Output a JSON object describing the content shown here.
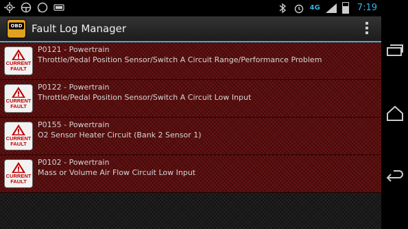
{
  "status_bar": {
    "time": "7:19",
    "network": "4G",
    "left_icons": [
      "gps-icon",
      "steering-wheel-icon",
      "whatsapp-icon",
      "obd-icon"
    ],
    "right_icons": [
      "bluetooth-icon",
      "alarm-icon",
      "lte-icon",
      "signal-icon",
      "battery-icon"
    ]
  },
  "action_bar": {
    "app_icon_label": "OBD",
    "title": "Fault Log Manager"
  },
  "faults": [
    {
      "code": "P0121 - Powertrain",
      "description": "Throttle/Pedal Position Sensor/Switch A Circuit Range/Performance Problem",
      "status_line1": "CURRENT",
      "status_line2": "FAULT"
    },
    {
      "code": "P0122 - Powertrain",
      "description": "Throttle/Pedal Position Sensor/Switch A Circuit Low Input",
      "status_line1": "CURRENT",
      "status_line2": "FAULT"
    },
    {
      "code": "P0155 - Powertrain",
      "description": "O2 Sensor Heater Circuit (Bank 2 Sensor 1)",
      "status_line1": "CURRENT",
      "status_line2": "FAULT"
    },
    {
      "code": "P0102 - Powertrain",
      "description": "Mass or Volume Air Flow Circuit Low Input",
      "status_line1": "CURRENT",
      "status_line2": "FAULT"
    }
  ],
  "nav_bar": [
    "recent-apps-icon",
    "home-icon",
    "back-icon"
  ],
  "colors": {
    "accent": "#33b5e5",
    "fault_row": "#5c0a0a",
    "fault_text": "#c00000"
  }
}
